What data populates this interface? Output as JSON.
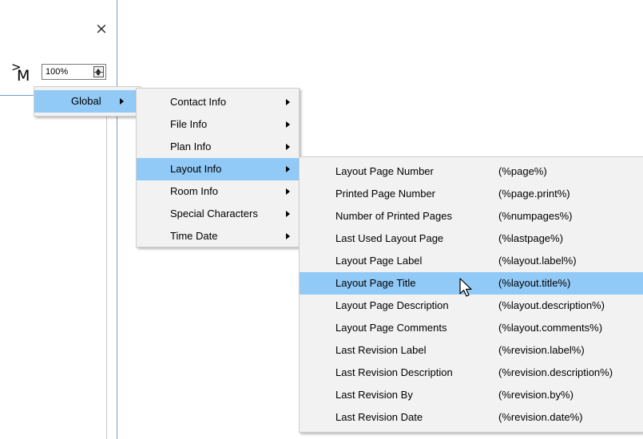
{
  "dialog": {
    "close_glyph": "×",
    "symbol_gt": ">",
    "symbol_m": "M",
    "zoom_value": "100%"
  },
  "menu_global": {
    "label": "Global"
  },
  "menu_categories": [
    {
      "label": "Contact Info"
    },
    {
      "label": "File Info"
    },
    {
      "label": "Plan Info"
    },
    {
      "label": "Layout Info"
    },
    {
      "label": "Room Info"
    },
    {
      "label": "Special Characters"
    },
    {
      "label": "Time  Date"
    }
  ],
  "menu_layout_info": [
    {
      "label": "Layout Page Number",
      "macro": "(%page%)"
    },
    {
      "label": "Printed Page Number",
      "macro": "(%page.print%)"
    },
    {
      "label": "Number of Printed Pages",
      "macro": "(%numpages%)"
    },
    {
      "label": "Last Used Layout Page",
      "macro": "(%lastpage%)"
    },
    {
      "label": "Layout Page Label",
      "macro": "(%layout.label%)"
    },
    {
      "label": "Layout Page Title",
      "macro": "(%layout.title%)"
    },
    {
      "label": "Layout Page Description",
      "macro": "(%layout.description%)"
    },
    {
      "label": "Layout Page Comments",
      "macro": "(%layout.comments%)"
    },
    {
      "label": "Last Revision Label",
      "macro": "(%revision.label%)"
    },
    {
      "label": "Last Revision Description",
      "macro": "(%revision.description%)"
    },
    {
      "label": "Last Revision By",
      "macro": "(%revision.by%)"
    },
    {
      "label": "Last Revision Date",
      "macro": "(%revision.date%)"
    }
  ],
  "colors": {
    "highlight": "#91c9f7",
    "menu_bg": "#f2f2f2",
    "dialog_border": "#7a9cc6"
  }
}
